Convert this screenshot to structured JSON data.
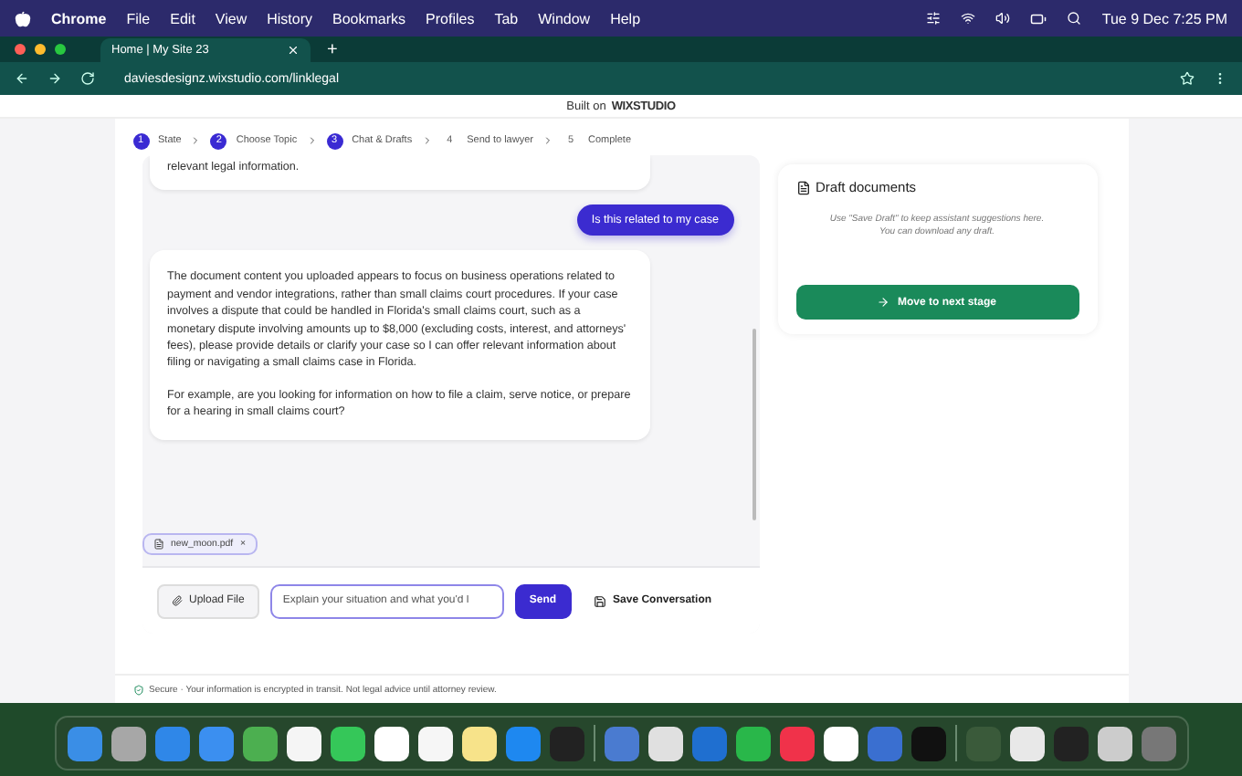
{
  "menu_bar": {
    "app": "Chrome",
    "items": [
      "File",
      "Edit",
      "View",
      "History",
      "Bookmarks",
      "Profiles",
      "Tab",
      "Window",
      "Help"
    ],
    "clock": "Tue 9 Dec  7:25 PM"
  },
  "browser": {
    "tab": {
      "title": "Home | My Site 23",
      "selected": true
    },
    "new_tab": "+",
    "url": "daviesdesignz.wixstudio.com/linklegal"
  },
  "banner": {
    "prefix": "Built on",
    "brand": "WIXSTUDIO"
  },
  "steps": [
    {
      "number": "1",
      "label": "State",
      "done": true
    },
    {
      "number": "2",
      "label": "Choose Topic",
      "done": true
    },
    {
      "number": "3",
      "label": "Chat & Drafts",
      "done": true
    },
    {
      "number": "4",
      "label": "Send to lawyer",
      "done": false
    },
    {
      "number": "5",
      "label": "Complete",
      "done": false
    }
  ],
  "messages": [
    {
      "kind": "assistant",
      "paragraphs": [
        "relevant legal information."
      ]
    },
    {
      "kind": "user",
      "paragraphs": [
        "Is this related to my case"
      ]
    },
    {
      "kind": "assistant",
      "paragraphs": [
        "The document content you uploaded appears to focus on business operations related to payment and vendor integrations, rather than small claims court procedures. If your case involves a dispute that could be handled in Florida's small claims court, such as a monetary dispute involving amounts up to $8,000 (excluding costs, interest, and attorneys' fees), please provide details or clarify your case so I can offer relevant information about filing or navigating a small claims case in Florida.",
        "For example, are you looking for information on how to file a claim, serve notice, or prepare for a hearing in small claims court?"
      ]
    }
  ],
  "attachment": {
    "name": "new_moon.pdf",
    "remove": "×"
  },
  "composer": {
    "upload": "Upload File",
    "placeholder": "Explain your situation and what you'd l",
    "send": "Send",
    "save": "Save Conversation"
  },
  "drafts": {
    "title": "Draft documents",
    "hint": "Use \"Save Draft\" to keep assistant suggestions here. You can download any draft.",
    "next": "Move to next stage"
  },
  "footer": "Secure · Your information is encrypted in transit. Not legal advice until attorney review."
}
